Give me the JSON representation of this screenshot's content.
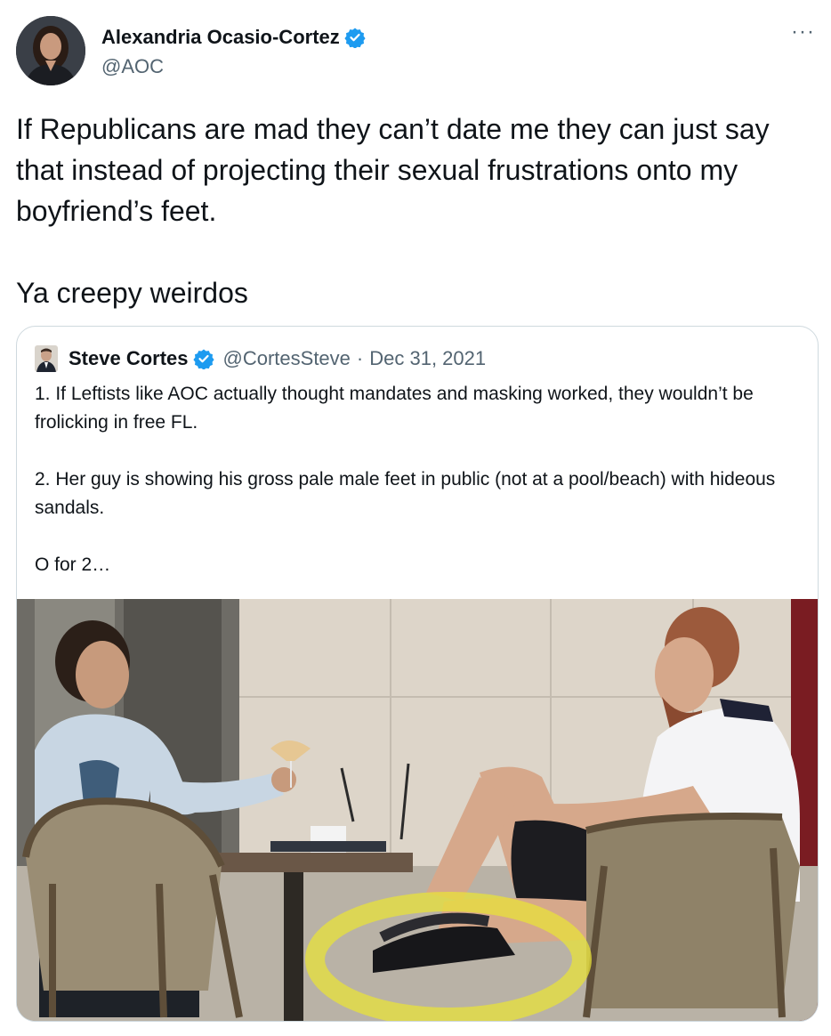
{
  "author": {
    "display_name": "Alexandria Ocasio-Cortez",
    "handle": "@AOC",
    "verified": true
  },
  "icons": {
    "verified": "verified-badge-icon",
    "more": "more-options-icon"
  },
  "more_label": "···",
  "tweet": {
    "text": "If Republicans are mad they can’t date me they can just say that instead of projecting their sexual frustrations onto my boyfriend’s feet.\n\nYa creepy weirdos"
  },
  "quoted_tweet": {
    "display_name": "Steve Cortes",
    "handle": "@CortesSteve",
    "separator": "·",
    "date": "Dec 31, 2021",
    "verified": true,
    "text": "1. If Leftists like AOC actually thought mandates and masking worked, they wouldn’t be frolicking in free FL.\n\n2. Her guy is showing his gross pale male feet in public (not at a pool/beach) with hideous sandals.\n\nO for 2…"
  },
  "colors": {
    "verified_blue": "#1d9bf0",
    "secondary_text": "#536471",
    "border": "#cfd9de",
    "highlight_yellow": "#e8e23a"
  }
}
